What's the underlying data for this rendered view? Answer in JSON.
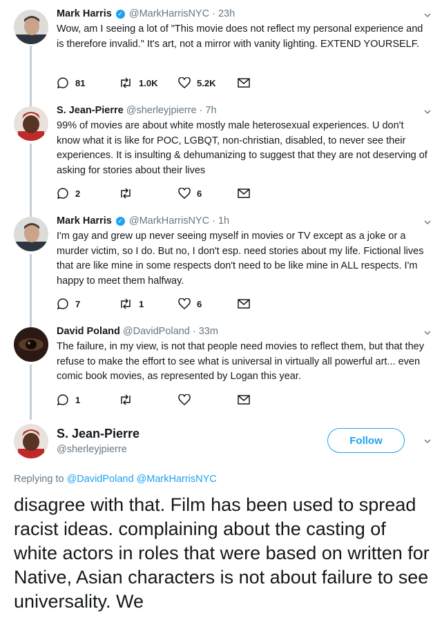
{
  "tweets": [
    {
      "name": "Mark Harris",
      "verified": true,
      "meta": "@MarkHarrisNYC · 23h",
      "text": "Wow, am I seeing a lot of \"This movie does not reflect my personal experience and is therefore invalid.\" It's art, not a mirror with vanity lighting. EXTEND YOURSELF.",
      "replies": "81",
      "retweets": "1.0K",
      "likes": "5.2K"
    },
    {
      "name": "S. Jean-Pierre",
      "verified": false,
      "meta": "@sherleyjpierre · 7h",
      "text": "99% of movies are about white mostly male heterosexual experiences. U don't know what it is like for POC, LGBQT, non-christian, disabled, to never see their experiences. It is insulting & dehumanizing to suggest that they are not deserving of asking for stories about their lives",
      "replies": "2",
      "retweets": "",
      "likes": "6"
    },
    {
      "name": "Mark Harris",
      "verified": true,
      "meta": "@MarkHarrisNYC · 1h",
      "text": "I'm gay and grew up never seeing myself in movies or TV except as a joke or a murder victim, so I do. But no, I don't esp. need stories about my life. Fictional lives that are like mine in some respects don't need to be like mine in ALL respects. I'm happy to meet them halfway.",
      "replies": "7",
      "retweets": "1",
      "likes": "6"
    },
    {
      "name": "David Poland",
      "verified": false,
      "meta": "@DavidPoland · 33m",
      "text": "The failure, in my view, is not that people need movies to reflect them, but that they refuse to make the effort to see what is universal in virtually all powerful art... even comic book movies, as represented by Logan this year.",
      "replies": "1",
      "retweets": "",
      "likes": ""
    }
  ],
  "focus": {
    "name": "S. Jean-Pierre",
    "handle": "@sherleyjpierre",
    "follow_label": "Follow",
    "replying_prefix": "Replying to ",
    "replying_to": "@DavidPoland @MarkHarrisNYC",
    "text": "disagree with that. Film has been used to spread racist ideas. complaining about the casting of white actors in roles that were based on written for Native, Asian characters is not about failure to see universality. We"
  },
  "colors": {
    "accent": "#1da1f2",
    "thread_line": "#c4cfd6",
    "muted": "#657786"
  }
}
